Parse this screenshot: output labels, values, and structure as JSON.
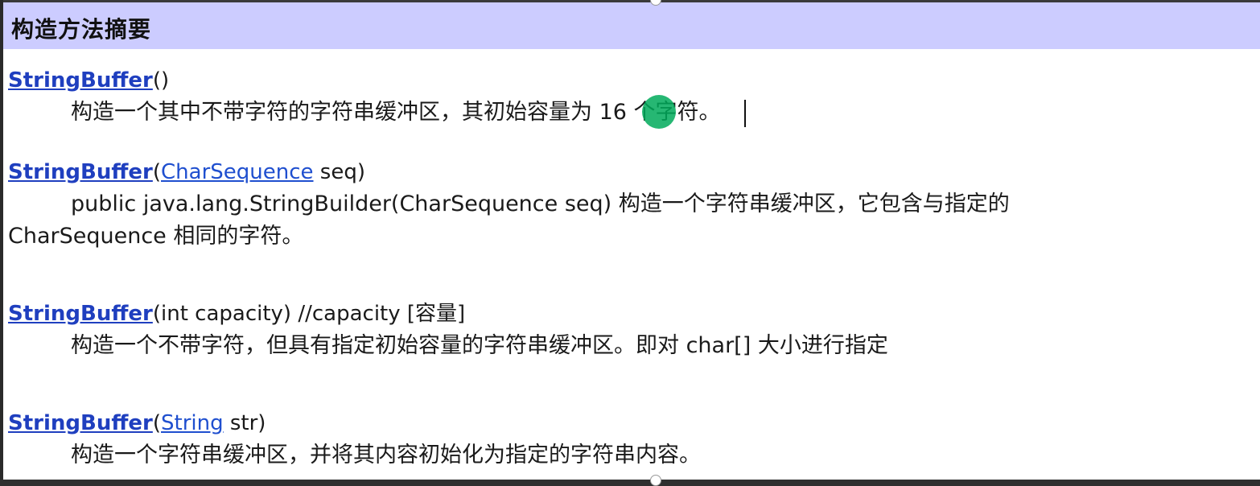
{
  "header": {
    "title": "构造方法摘要"
  },
  "entries": [
    {
      "method": "StringBuffer",
      "sig_rest": "()",
      "desc": "构造一个其中不带字符的字符串缓冲区，其初始容量为 16 个字符。"
    },
    {
      "method": "StringBuffer",
      "open": "(",
      "param_type": "CharSequence",
      "param_rest": " seq)",
      "desc_line1": "public java.lang.StringBuilder(CharSequence seq) 构造一个字符串缓冲区，它包含与指定的",
      "desc_line2": "CharSequence 相同的字符。"
    },
    {
      "method": "StringBuffer",
      "sig_rest": "(int capacity)  //capacity [容量]",
      "desc": "构造一个不带字符，但具有指定初始容量的字符串缓冲区。即对 char[] 大小进行指定"
    },
    {
      "method": "StringBuffer",
      "open": "(",
      "param_type": "String",
      "param_rest": " str)",
      "desc": "构造一个字符串缓冲区，并将其内容初始化为指定的字符串内容。"
    }
  ],
  "colors": {
    "header_bg": "#ccccff",
    "link": "#1f3fbf",
    "pointer": "#00aa5a"
  },
  "icons": {
    "pointer": "green-cursor-highlight-icon"
  }
}
